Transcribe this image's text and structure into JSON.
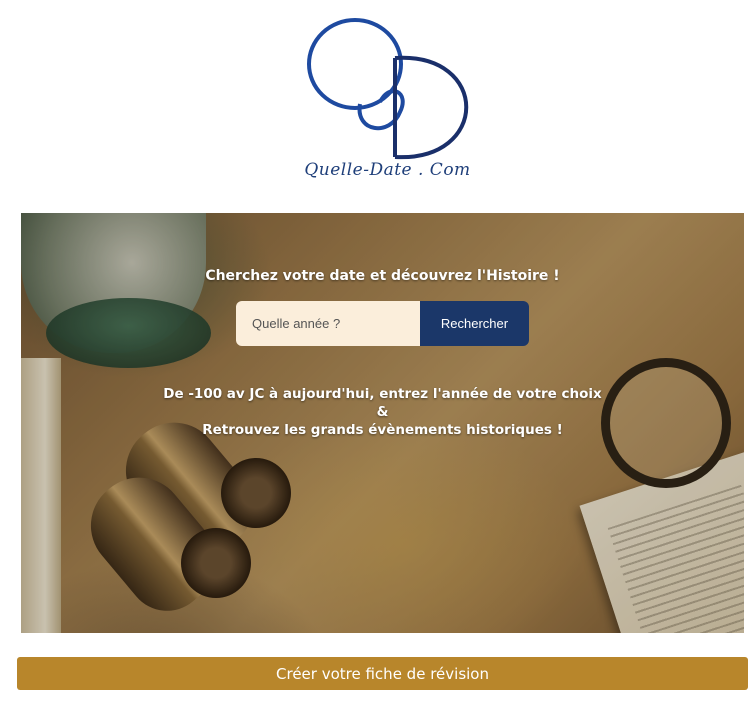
{
  "logo": {
    "text": "Quelle-Date . Com"
  },
  "hero": {
    "title": "Cherchez votre date et découvrez l'Histoire !",
    "description_line1": "De -100 av JC à aujourd'hui, entrez l'année de votre choix",
    "description_line2": "&",
    "description_line3": "Retrouvez les grands évènements historiques !"
  },
  "search": {
    "placeholder": "Quelle année ?",
    "value": "",
    "button_label": "Rechercher"
  },
  "cta": {
    "label": "Créer votre fiche de révision"
  },
  "colors": {
    "brand_blue": "#1b3769",
    "cta_gold": "#b8862b",
    "input_bg": "#fbeedb"
  }
}
